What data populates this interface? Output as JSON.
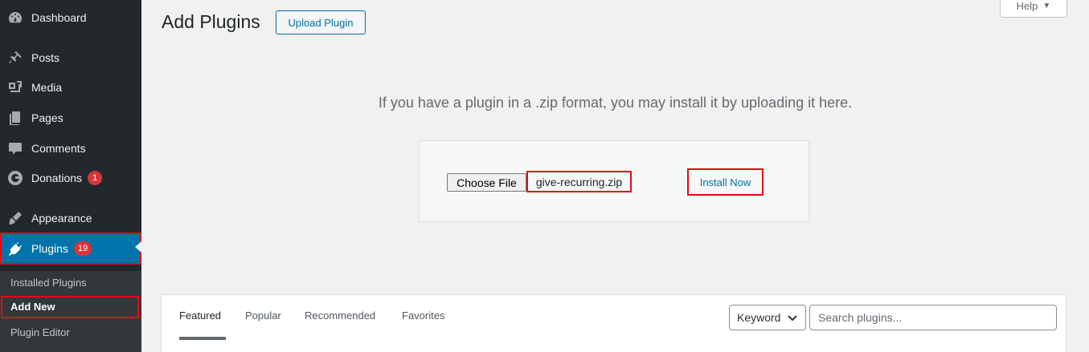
{
  "sidebar": {
    "items": [
      {
        "label": "Dashboard",
        "icon": "dashboard-icon"
      },
      {
        "label": "Posts",
        "icon": "pin-icon"
      },
      {
        "label": "Media",
        "icon": "media-icon"
      },
      {
        "label": "Pages",
        "icon": "pages-icon"
      },
      {
        "label": "Comments",
        "icon": "comment-icon"
      },
      {
        "label": "Donations",
        "icon": "give-icon",
        "badge": "1"
      },
      {
        "label": "Appearance",
        "icon": "brush-icon"
      },
      {
        "label": "Plugins",
        "icon": "plugin-icon",
        "badge": "19",
        "active": true
      }
    ],
    "submenu": [
      {
        "label": "Installed Plugins"
      },
      {
        "label": "Add New",
        "current": true
      },
      {
        "label": "Plugin Editor"
      }
    ]
  },
  "header": {
    "title": "Add Plugins",
    "upload_button": "Upload Plugin",
    "help_button": "Help",
    "help_caret": "▼"
  },
  "upload": {
    "instructions": "If you have a plugin in a .zip format, you may install it by uploading it here.",
    "choose_file_label": "Choose File",
    "file_name": "give-recurring.zip",
    "install_button": "Install Now"
  },
  "filter": {
    "tabs": [
      {
        "label": "Featured",
        "current": true
      },
      {
        "label": "Popular"
      },
      {
        "label": "Recommended"
      },
      {
        "label": "Favorites"
      }
    ],
    "search_type": "Keyword",
    "search_placeholder": "Search plugins..."
  },
  "colors": {
    "sidebar_bg": "#23282d",
    "active_bg": "#0073aa",
    "badge": "#d63638",
    "highlight_box": "#e50914"
  }
}
